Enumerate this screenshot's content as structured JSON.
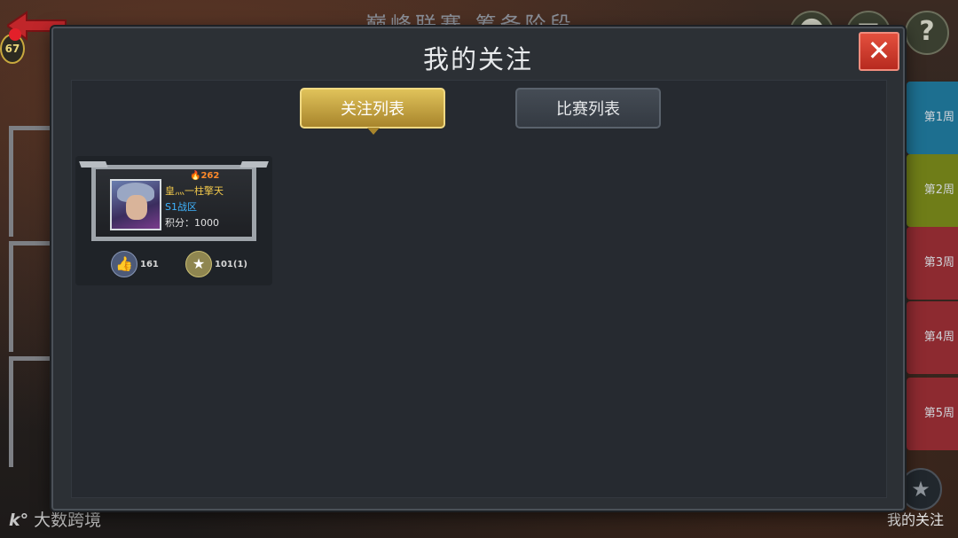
{
  "background": {
    "title": "巅峰联赛 筹备阶段",
    "back_badge": "67",
    "help_label": "?",
    "week_tabs": [
      "第1周",
      "第2周",
      "第3周",
      "第4周",
      "第5周"
    ],
    "corner_label": "我的关注",
    "watermark": {
      "logo": "k°",
      "text": "大数跨境"
    }
  },
  "modal": {
    "title": "我的关注",
    "close_label": "✕",
    "tabs": [
      {
        "label": "关注列表",
        "active": true
      },
      {
        "label": "比赛列表",
        "active": false
      }
    ]
  },
  "player_card": {
    "heat": "262",
    "name": "皇灬一柱擎天",
    "server": "S1战区",
    "score": "积分：1000",
    "likes": "161",
    "favorites": "101(1)"
  },
  "colors": {
    "accent_gold": "#c9a646",
    "close_red": "#d8412f",
    "week1": "#1d6f90",
    "week2": "#6f7d18",
    "week_rest": "#8d2a30"
  }
}
